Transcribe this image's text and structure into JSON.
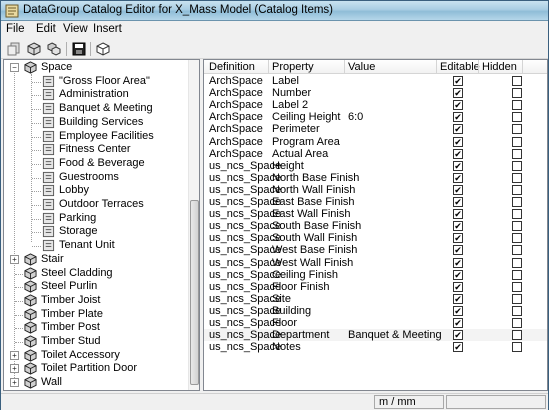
{
  "window": {
    "title": "DataGroup Catalog Editor for X_Mass Model (Catalog Items)"
  },
  "menu": [
    "File",
    "Edit",
    "View",
    "Insert"
  ],
  "toolbar": {
    "icons": [
      "copy-icon",
      "cube-icon",
      "cube-group-icon",
      "save-icon",
      "cube-outline-icon"
    ]
  },
  "tree": {
    "items": [
      {
        "label": "Space",
        "level": 0,
        "expander": "−",
        "icon": "cube-icon"
      },
      {
        "label": "\"Gross Floor Area\"",
        "level": 1,
        "icon": "doc-icon"
      },
      {
        "label": "Administration",
        "level": 1,
        "icon": "doc-icon"
      },
      {
        "label": "Banquet & Meeting",
        "level": 1,
        "icon": "doc-icon",
        "selected": true
      },
      {
        "label": "Building Services",
        "level": 1,
        "icon": "doc-icon"
      },
      {
        "label": "Employee Facilities",
        "level": 1,
        "icon": "doc-icon"
      },
      {
        "label": "Fitness Center",
        "level": 1,
        "icon": "doc-icon"
      },
      {
        "label": "Food & Beverage",
        "level": 1,
        "icon": "doc-icon"
      },
      {
        "label": "Guestrooms",
        "level": 1,
        "icon": "doc-icon"
      },
      {
        "label": "Lobby",
        "level": 1,
        "icon": "doc-icon"
      },
      {
        "label": "Outdoor Terraces",
        "level": 1,
        "icon": "doc-icon"
      },
      {
        "label": "Parking",
        "level": 1,
        "icon": "doc-icon"
      },
      {
        "label": "Storage",
        "level": 1,
        "icon": "doc-icon"
      },
      {
        "label": "Tenant Unit",
        "level": 1,
        "icon": "doc-icon"
      },
      {
        "label": "Stair",
        "level": 0,
        "expander": "+",
        "icon": "cube-icon"
      },
      {
        "label": "Steel Cladding",
        "level": 0,
        "icon": "cube-icon"
      },
      {
        "label": "Steel Purlin",
        "level": 0,
        "icon": "cube-icon"
      },
      {
        "label": "Timber Joist",
        "level": 0,
        "icon": "cube-icon"
      },
      {
        "label": "Timber Plate",
        "level": 0,
        "icon": "cube-icon"
      },
      {
        "label": "Timber Post",
        "level": 0,
        "icon": "cube-icon"
      },
      {
        "label": "Timber Stud",
        "level": 0,
        "icon": "cube-icon"
      },
      {
        "label": "Toilet Accessory",
        "level": 0,
        "expander": "+",
        "icon": "cube-icon"
      },
      {
        "label": "Toilet Partition Door",
        "level": 0,
        "expander": "+",
        "icon": "cube-icon"
      },
      {
        "label": "Wall",
        "level": 0,
        "expander": "+",
        "icon": "cube-icon"
      }
    ]
  },
  "table": {
    "columns": [
      "Definition",
      "Property",
      "Value",
      "Editable",
      "Hidden"
    ],
    "rows": [
      {
        "definition": "ArchSpace",
        "property": "Label",
        "value": "",
        "editable": true,
        "hidden": false
      },
      {
        "definition": "ArchSpace",
        "property": "Number",
        "value": "",
        "editable": true,
        "hidden": false
      },
      {
        "definition": "ArchSpace",
        "property": "Label 2",
        "value": "",
        "editable": true,
        "hidden": false
      },
      {
        "definition": "ArchSpace",
        "property": "Ceiling Height",
        "value": "6:0",
        "editable": true,
        "hidden": false
      },
      {
        "definition": "ArchSpace",
        "property": "Perimeter",
        "value": "",
        "editable": true,
        "hidden": false
      },
      {
        "definition": "ArchSpace",
        "property": "Program Area",
        "value": "",
        "editable": true,
        "hidden": false
      },
      {
        "definition": "ArchSpace",
        "property": "Actual Area",
        "value": "",
        "editable": true,
        "hidden": false
      },
      {
        "definition": "us_ncs_Space",
        "property": "Height",
        "value": "",
        "editable": true,
        "hidden": false
      },
      {
        "definition": "us_ncs_Space",
        "property": "North Base Finish",
        "value": "",
        "editable": true,
        "hidden": false
      },
      {
        "definition": "us_ncs_Space",
        "property": "North Wall Finish",
        "value": "",
        "editable": true,
        "hidden": false
      },
      {
        "definition": "us_ncs_Space",
        "property": "East Base Finish",
        "value": "",
        "editable": true,
        "hidden": false
      },
      {
        "definition": "us_ncs_Space",
        "property": "East Wall Finish",
        "value": "",
        "editable": true,
        "hidden": false
      },
      {
        "definition": "us_ncs_Space",
        "property": "South Base Finish",
        "value": "",
        "editable": true,
        "hidden": false
      },
      {
        "definition": "us_ncs_Space",
        "property": "South Wall Finish",
        "value": "",
        "editable": true,
        "hidden": false
      },
      {
        "definition": "us_ncs_Space",
        "property": "West Base Finish",
        "value": "",
        "editable": true,
        "hidden": false
      },
      {
        "definition": "us_ncs_Space",
        "property": "West Wall Finish",
        "value": "",
        "editable": true,
        "hidden": false
      },
      {
        "definition": "us_ncs_Space",
        "property": "Ceiling Finish",
        "value": "",
        "editable": true,
        "hidden": false
      },
      {
        "definition": "us_ncs_Space",
        "property": "Floor Finish",
        "value": "",
        "editable": true,
        "hidden": false
      },
      {
        "definition": "us_ncs_Space",
        "property": "Site",
        "value": "",
        "editable": true,
        "hidden": false
      },
      {
        "definition": "us_ncs_Space",
        "property": "Building",
        "value": "",
        "editable": true,
        "hidden": false
      },
      {
        "definition": "us_ncs_Space",
        "property": "Floor",
        "value": "",
        "editable": true,
        "hidden": false
      },
      {
        "definition": "us_ncs_Space",
        "property": "Department",
        "value": "Banquet & Meeting",
        "editable": true,
        "hidden": false
      },
      {
        "definition": "us_ncs_Space",
        "property": "Notes",
        "value": "",
        "editable": true,
        "hidden": false
      }
    ]
  },
  "status": {
    "units": "m / mm"
  }
}
